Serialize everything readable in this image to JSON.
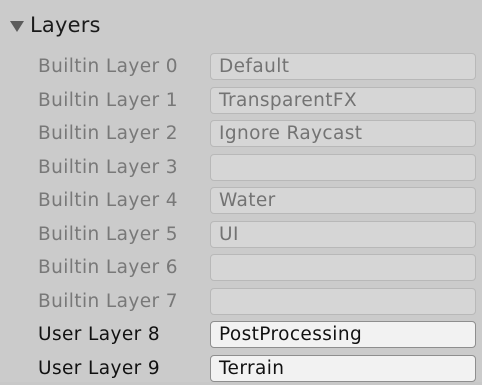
{
  "section": {
    "title": "Layers",
    "expanded": true
  },
  "layers": [
    {
      "label": "Builtin Layer 0",
      "value": "Default",
      "editable": false
    },
    {
      "label": "Builtin Layer 1",
      "value": "TransparentFX",
      "editable": false
    },
    {
      "label": "Builtin Layer 2",
      "value": "Ignore Raycast",
      "editable": false
    },
    {
      "label": "Builtin Layer 3",
      "value": "",
      "editable": false
    },
    {
      "label": "Builtin Layer 4",
      "value": "Water",
      "editable": false
    },
    {
      "label": "Builtin Layer 5",
      "value": "UI",
      "editable": false
    },
    {
      "label": "Builtin Layer 6",
      "value": "",
      "editable": false
    },
    {
      "label": "Builtin Layer 7",
      "value": "",
      "editable": false
    },
    {
      "label": "User Layer 8",
      "value": "PostProcessing",
      "editable": true
    },
    {
      "label": "User Layer 9",
      "value": "Terrain",
      "editable": true
    }
  ]
}
